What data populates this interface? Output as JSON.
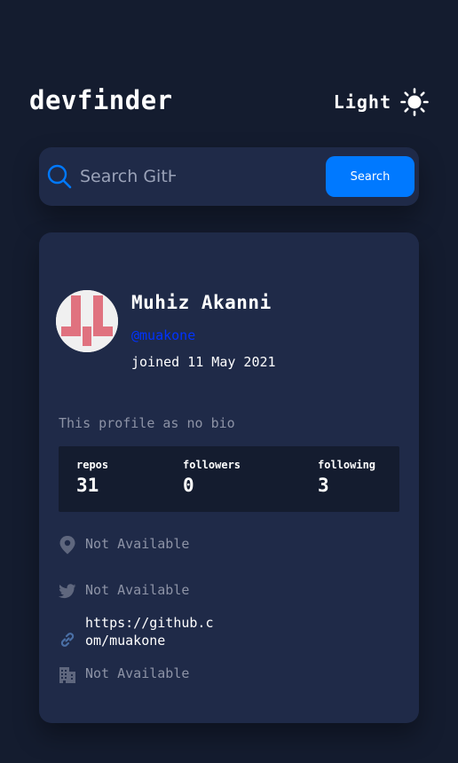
{
  "header": {
    "logo": "devfinder",
    "theme_label": "Light",
    "theme_icon": "sun-icon"
  },
  "search": {
    "placeholder": "Search GitHub username…",
    "button_label": "Search",
    "icon": "search-icon"
  },
  "profile": {
    "name": "Muhiz Akanni",
    "username": "@muakone",
    "joined": "joined 11 May 2021",
    "bio": "This profile as no bio",
    "stats": [
      {
        "label": "repos",
        "value": "31"
      },
      {
        "label": "followers",
        "value": "0"
      },
      {
        "label": "following",
        "value": "3"
      }
    ],
    "links": {
      "location": "Not Available",
      "twitter": "Not Available",
      "blog": "https://github.com/muakone",
      "company": "Not Available"
    }
  },
  "colors": {
    "background": "#141c2f",
    "card": "#1f2a48",
    "accent": "#0079ff",
    "muted": "#8d93a6",
    "avatar_pattern": "#e0727f"
  }
}
